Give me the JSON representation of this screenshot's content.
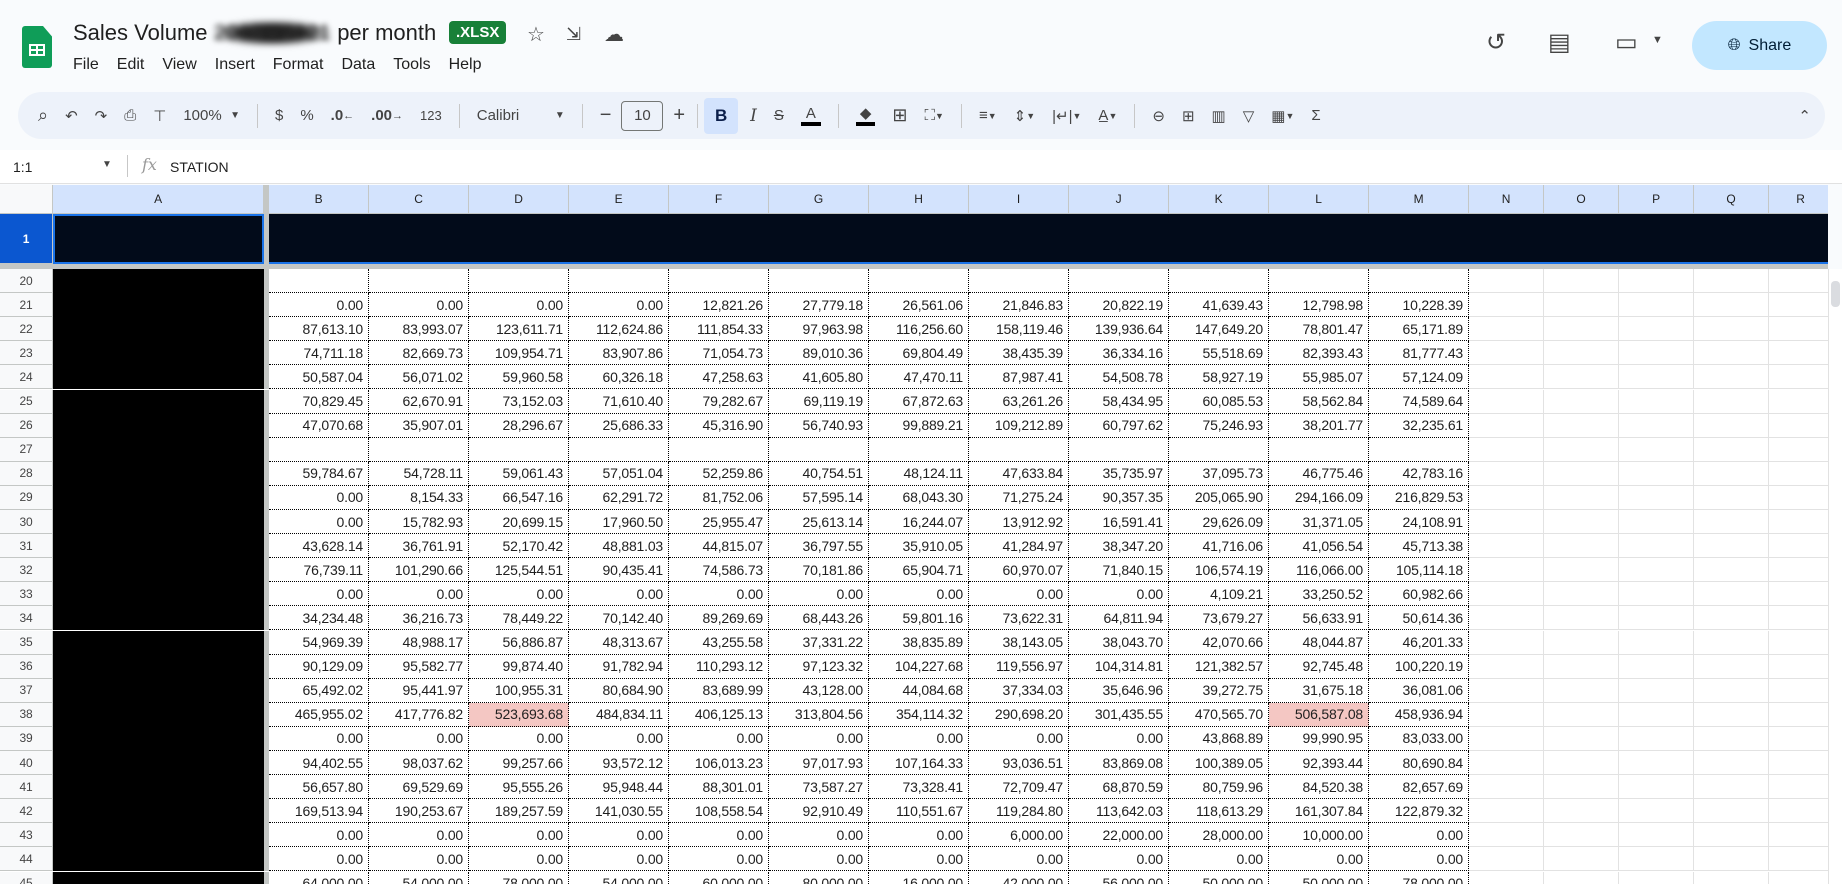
{
  "doc": {
    "title_prefix": "Sales Volume ",
    "title_redacted": "2016 - 2021",
    "title_suffix": " per month",
    "badge": ".XLSX",
    "menu": [
      "File",
      "Edit",
      "View",
      "Insert",
      "Format",
      "Data",
      "Tools",
      "Help"
    ],
    "share_label": "Share"
  },
  "toolbar": {
    "zoom": "100%",
    "currency": "$",
    "percent": "%",
    "dec_decrease": ".0",
    "dec_increase": ".00",
    "number_format": "123",
    "font": "Calibri",
    "font_size": "10",
    "bold": "B",
    "italic": "I",
    "text_color": "A",
    "sum": "Σ"
  },
  "formula_bar": {
    "name_box": "1:1",
    "fx": "fx",
    "value": "STATION"
  },
  "colors": {
    "accent": "#0b57d0",
    "highlight": "#f4c7c3",
    "share": "#c2e7ff"
  },
  "sheet": {
    "columns": [
      "A",
      "B",
      "C",
      "D",
      "E",
      "F",
      "G",
      "H",
      "I",
      "J",
      "K",
      "L",
      "M",
      "N",
      "O",
      "P",
      "Q",
      "R"
    ],
    "frozen_row": "1",
    "rows": [
      {
        "n": "20",
        "v": [
          "",
          "",
          "",
          "",
          "",
          "",
          "",
          "",
          "",
          "",
          "",
          ""
        ]
      },
      {
        "n": "21",
        "v": [
          "0.00",
          "0.00",
          "0.00",
          "0.00",
          "12,821.26",
          "27,779.18",
          "26,561.06",
          "21,846.83",
          "20,822.19",
          "41,639.43",
          "12,798.98",
          "10,228.39"
        ]
      },
      {
        "n": "22",
        "v": [
          "87,613.10",
          "83,993.07",
          "123,611.71",
          "112,624.86",
          "111,854.33",
          "97,963.98",
          "116,256.60",
          "158,119.46",
          "139,936.64",
          "147,649.20",
          "78,801.47",
          "65,171.89"
        ]
      },
      {
        "n": "23",
        "v": [
          "74,711.18",
          "82,669.73",
          "109,954.71",
          "83,907.86",
          "71,054.73",
          "89,010.36",
          "69,804.49",
          "38,435.39",
          "36,334.16",
          "55,518.69",
          "82,393.43",
          "81,777.43"
        ]
      },
      {
        "n": "24",
        "v": [
          "50,587.04",
          "56,071.02",
          "59,960.58",
          "60,326.18",
          "47,258.63",
          "41,605.80",
          "47,470.11",
          "87,987.41",
          "54,508.78",
          "58,927.19",
          "55,985.07",
          "57,124.09"
        ]
      },
      {
        "n": "25",
        "v": [
          "70,829.45",
          "62,670.91",
          "73,152.03",
          "71,610.40",
          "79,282.67",
          "69,119.19",
          "67,872.63",
          "63,261.26",
          "58,434.95",
          "60,085.53",
          "58,562.84",
          "74,589.64"
        ]
      },
      {
        "n": "26",
        "v": [
          "47,070.68",
          "35,907.01",
          "28,296.67",
          "25,686.33",
          "45,316.90",
          "56,740.93",
          "99,889.21",
          "109,212.89",
          "60,797.62",
          "75,246.93",
          "38,201.77",
          "32,235.61"
        ]
      },
      {
        "n": "27",
        "v": [
          "",
          "",
          "",
          "",
          "",
          "",
          "",
          "",
          "",
          "",
          "",
          ""
        ]
      },
      {
        "n": "28",
        "v": [
          "59,784.67",
          "54,728.11",
          "59,061.43",
          "57,051.04",
          "52,259.86",
          "40,754.51",
          "48,124.11",
          "47,633.84",
          "35,735.97",
          "37,095.73",
          "46,775.46",
          "42,783.16"
        ]
      },
      {
        "n": "29",
        "v": [
          "0.00",
          "8,154.33",
          "66,547.16",
          "62,291.72",
          "81,752.06",
          "57,595.14",
          "68,043.30",
          "71,275.24",
          "90,357.35",
          "205,065.90",
          "294,166.09",
          "216,829.53"
        ]
      },
      {
        "n": "30",
        "v": [
          "0.00",
          "15,782.93",
          "20,699.15",
          "17,960.50",
          "25,955.47",
          "25,613.14",
          "16,244.07",
          "13,912.92",
          "16,591.41",
          "29,626.09",
          "31,371.05",
          "24,108.91"
        ]
      },
      {
        "n": "31",
        "v": [
          "43,628.14",
          "36,761.91",
          "52,170.42",
          "48,881.03",
          "44,815.07",
          "36,797.55",
          "35,910.05",
          "41,284.97",
          "38,347.20",
          "41,716.06",
          "41,056.54",
          "45,713.38"
        ]
      },
      {
        "n": "32",
        "v": [
          "76,739.11",
          "101,290.66",
          "125,544.51",
          "90,435.41",
          "74,586.73",
          "70,181.86",
          "65,904.71",
          "60,970.07",
          "71,840.15",
          "106,574.19",
          "116,066.00",
          "105,114.18"
        ]
      },
      {
        "n": "33",
        "v": [
          "0.00",
          "0.00",
          "0.00",
          "0.00",
          "0.00",
          "0.00",
          "0.00",
          "0.00",
          "0.00",
          "4,109.21",
          "33,250.52",
          "60,982.66"
        ]
      },
      {
        "n": "34",
        "v": [
          "34,234.48",
          "36,216.73",
          "78,449.22",
          "70,142.40",
          "89,269.69",
          "68,443.26",
          "59,801.16",
          "73,622.31",
          "64,811.94",
          "73,679.27",
          "56,633.91",
          "50,614.36"
        ]
      },
      {
        "n": "35",
        "v": [
          "54,969.39",
          "48,988.17",
          "56,886.87",
          "48,313.67",
          "43,255.58",
          "37,331.22",
          "38,835.89",
          "38,143.05",
          "38,043.70",
          "42,070.66",
          "48,044.87",
          "46,201.33"
        ]
      },
      {
        "n": "36",
        "v": [
          "90,129.09",
          "95,582.77",
          "99,874.40",
          "91,782.94",
          "110,293.12",
          "97,123.32",
          "104,227.68",
          "119,556.97",
          "104,314.81",
          "121,382.57",
          "92,745.48",
          "100,220.19"
        ]
      },
      {
        "n": "37",
        "v": [
          "65,492.02",
          "95,441.97",
          "100,955.31",
          "80,684.90",
          "83,689.99",
          "43,128.00",
          "44,084.68",
          "37,334.03",
          "35,646.96",
          "39,272.75",
          "31,675.18",
          "36,081.06"
        ]
      },
      {
        "n": "38",
        "v": [
          "465,955.02",
          "417,776.82",
          "523,693.68",
          "484,834.11",
          "406,125.13",
          "313,804.56",
          "354,114.32",
          "290,698.20",
          "301,435.55",
          "470,565.70",
          "506,587.08",
          "458,936.94"
        ],
        "highlight": [
          2,
          10
        ]
      },
      {
        "n": "39",
        "v": [
          "0.00",
          "0.00",
          "0.00",
          "0.00",
          "0.00",
          "0.00",
          "0.00",
          "0.00",
          "0.00",
          "43,868.89",
          "99,990.95",
          "83,033.00"
        ]
      },
      {
        "n": "40",
        "v": [
          "94,402.55",
          "98,037.62",
          "99,257.66",
          "93,572.12",
          "106,013.23",
          "97,017.93",
          "107,164.33",
          "93,036.51",
          "83,869.08",
          "100,389.05",
          "92,393.44",
          "80,690.84"
        ]
      },
      {
        "n": "41",
        "v": [
          "56,657.80",
          "69,529.69",
          "95,555.26",
          "95,948.44",
          "88,301.01",
          "73,587.27",
          "73,328.41",
          "72,709.47",
          "68,870.59",
          "80,759.96",
          "84,520.38",
          "82,657.69"
        ]
      },
      {
        "n": "42",
        "v": [
          "169,513.94",
          "190,253.67",
          "189,257.59",
          "141,030.55",
          "108,558.54",
          "92,910.49",
          "110,551.67",
          "119,284.80",
          "113,642.03",
          "118,613.29",
          "161,307.84",
          "122,879.32"
        ]
      },
      {
        "n": "43",
        "v": [
          "0.00",
          "0.00",
          "0.00",
          "0.00",
          "0.00",
          "0.00",
          "0.00",
          "6,000.00",
          "22,000.00",
          "28,000.00",
          "10,000.00",
          "0.00"
        ]
      },
      {
        "n": "44",
        "v": [
          "0.00",
          "0.00",
          "0.00",
          "0.00",
          "0.00",
          "0.00",
          "0.00",
          "0.00",
          "0.00",
          "0.00",
          "0.00",
          "0.00"
        ]
      },
      {
        "n": "45",
        "v": [
          "64,000.00",
          "54,000.00",
          "78,000.00",
          "54,000.00",
          "60,000.00",
          "80,000.00",
          "16,000.00",
          "42,000.00",
          "56,000.00",
          "50,000.00",
          "50,000.00",
          "78,000.00"
        ]
      }
    ]
  }
}
